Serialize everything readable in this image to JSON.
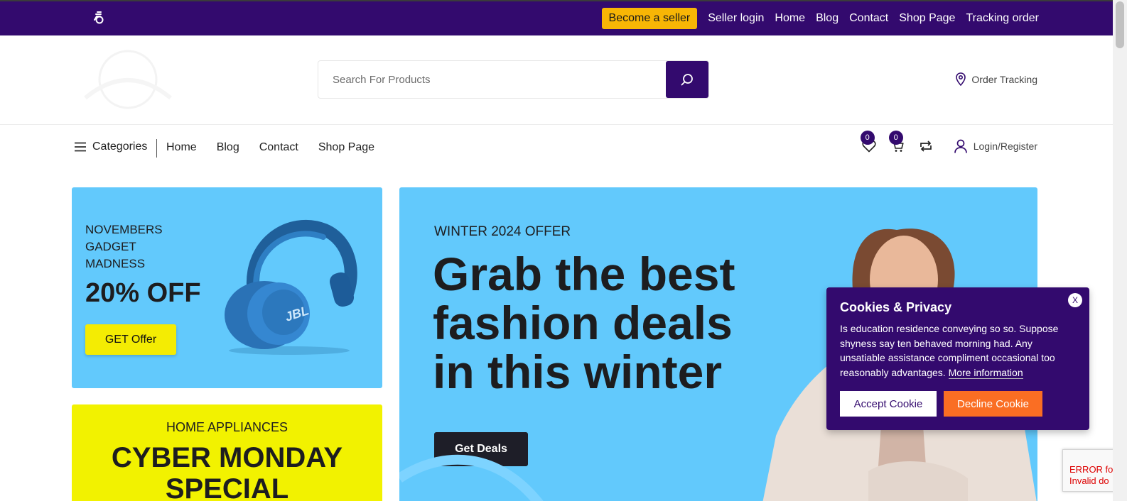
{
  "topbar": {
    "seller_cta": "Become a seller",
    "links": [
      "Seller login",
      "Home",
      "Blog",
      "Contact",
      "Shop Page",
      "Tracking order"
    ]
  },
  "header": {
    "search": {
      "placeholder": "Search For Products"
    },
    "order_tracking": "Order Tracking"
  },
  "subnav": {
    "categories_label": "Categories",
    "links": [
      "Home",
      "Blog",
      "Contact",
      "Shop Page"
    ],
    "wishlist_count": "0",
    "cart_count": "0",
    "login_label": "Login/Register"
  },
  "banners": {
    "gadget": {
      "kicker": "NOVEMBERS GADGET MADNESS",
      "headline": "20% OFF",
      "button": "GET Offer",
      "product_brand": "JBL"
    },
    "appliances": {
      "kicker": "HOME APPLIANCES",
      "headline": "CYBER MONDAY SPECIAL"
    },
    "winter": {
      "kicker": "WINTER 2024 OFFER",
      "headline": "Grab the best fashion deals in this winter",
      "button": "Get Deals"
    }
  },
  "cookie": {
    "title": "Cookies & Privacy",
    "close": "X",
    "text": "Is education residence conveying so so. Suppose shyness say ten behaved morning had. Any unsatiable assistance compliment occasional too reasonably advantages.",
    "more_link": "More information",
    "accept": "Accept Cookie",
    "decline": "Decline Cookie"
  },
  "recaptcha": {
    "line1": "ERROR fo",
    "line2": "Invalid do"
  },
  "colors": {
    "brand_purple": "#330a6e",
    "seller_yellow": "#f8b605",
    "banner_blue": "#62c9fc",
    "banner_yellow": "#f2f200",
    "decline_orange": "#fa6e23"
  }
}
